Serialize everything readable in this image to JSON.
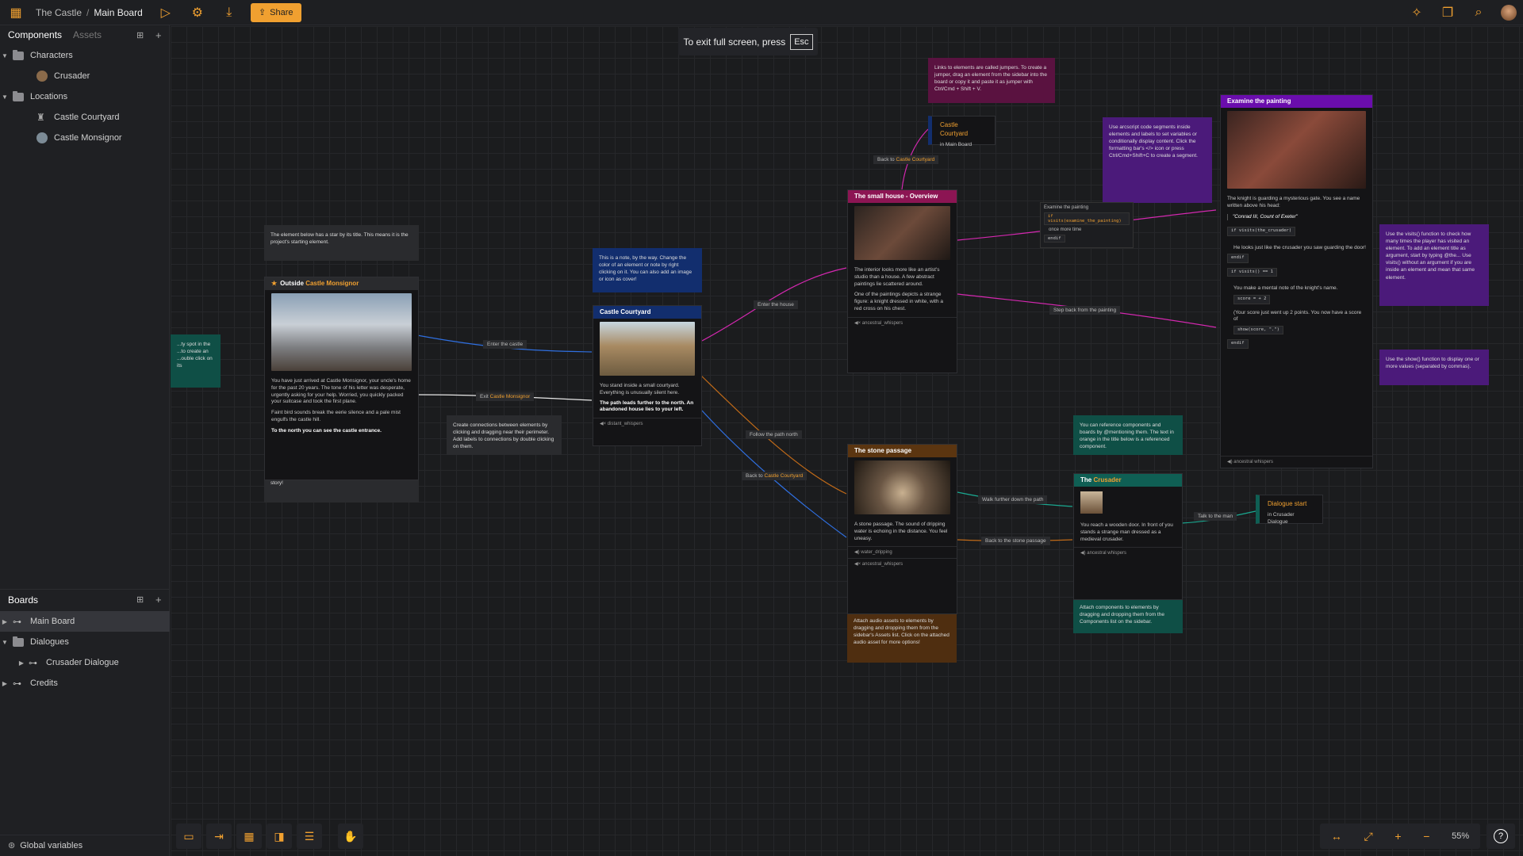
{
  "header": {
    "project": "The Castle",
    "separator": "/",
    "board": "Main Board",
    "share": "Share"
  },
  "sidebar": {
    "tab_components": "Components",
    "tab_assets": "Assets",
    "characters": "Characters",
    "crusader": "Crusader",
    "locations": "Locations",
    "courtyard": "Castle Courtyard",
    "monsignor": "Castle Monsignor",
    "boards_title": "Boards",
    "main_board": "Main Board",
    "dialogues": "Dialogues",
    "crusader_dialogue": "Crusader Dialogue",
    "credits": "Credits",
    "global_vars": "Global variables"
  },
  "fullscreen": {
    "text": "To exit full screen, press",
    "key": "Esc"
  },
  "nodes": {
    "outside": {
      "title_a": "Outside",
      "title_b": "Castle Monsignor",
      "body1": "You have just arrived at Castle Monsignor, your uncle's home for the past 20 years. The tone of his letter was desperate, urgently asking for your help. Worried, you quickly packed your suitcase and took the first plane.",
      "body2": "Faint bird sounds break the eerie silence and a pale mist engulfs the castle hill.",
      "body3": "To the north you can see the castle entrance."
    },
    "courtyard": {
      "title": "Castle Courtyard",
      "body1": "You stand inside a small courtyard. Everything is unusually silent here.",
      "body2": "The path leads further to the north. An abandoned house lies to your left.",
      "audio": "distant_whispers"
    },
    "house": {
      "title": "The small house - Overview",
      "body1": "The interior looks more like an artist's studio than a house. A few abstract paintings lie scattered around.",
      "body2": "One of the paintings depicts a strange figure: a knight dressed in white, with a red cross on his chest.",
      "audio": "ancestral_whispers"
    },
    "passage": {
      "title": "The stone passage",
      "body": "A stone passage. The sound of dripping water is echoing in the distance. You feel uneasy.",
      "audio1": "water_dripping",
      "audio2": "ancestral_whispers"
    },
    "crusader": {
      "title_a": "The",
      "title_b": "Crusader",
      "body": "You reach a wooden door. In front of you stands a strange man dressed as a medieval crusader.",
      "audio": "ancestral whispers"
    },
    "painting": {
      "title": "Examine the painting",
      "body1": "The knight is guarding a mysterious gate. You see a name written above his head:",
      "quote": "\"Conrad III, Count of Exeter\"",
      "code1": "if visits(the_crusader)",
      "body2": "He looks just like the crusader you saw guarding the door!",
      "code2": "endif",
      "code3": "if visits() == 1",
      "body3": "You make a mental note of the knight's name.",
      "code4": "score = + 2",
      "body4": "(Your score just went up 2 points. You now have a score of",
      "code5": "show(score, \".\")",
      "code6": "endif",
      "audio": "ancestral whispers"
    },
    "jumper": {
      "title": "Castle Courtyard",
      "sub": "in Main Board"
    },
    "dialogue": {
      "title": "Dialogue start",
      "sub": "in Crusader Dialogue"
    }
  },
  "notes": {
    "start": "The element below has a star by its title. This means it is the project's starting element.",
    "play": "Click on the Play Mode button on the top menu to run the story!",
    "note_blue": "This is a note, by the way. Change the color of an element or note by right clicking on it. You can also add an image or icon as cover!",
    "connections": "Create connections between elements by clicking and dragging near their perimeter. Add labels to connections by double clicking on them.",
    "jumpers": "Links to elements are called jumpers. To create a jumper, drag an element from the sidebar into the board or copy it and paste it as jumper with Ctrl/Cmd + Shift + V.",
    "arcscript": "Use arcscript code segments inside elements and labels to set variables or conditionally display content. Click the formatting bar's </> icon or press Ctrl/Cmd+Shift+C to create a segment.",
    "visits": "Use the visits() function to check how many times the player has visited an element. To add an element title as argument, start by typing @the... Use visits() without an argument if you are inside an element and mean that same element.",
    "show": "Use the show() function to display one or more values (separated by commas).",
    "reference": "You can reference components and boards by @mentioning them. The text in orange in the title below is a referenced component.",
    "components": "Attach components to elements by dragging and dropping them from the Components list on the sidebar.",
    "audio": "Attach audio assets to elements by dragging and dropping them from the sidebar's Assets list. Click on the attached audio asset for more options!",
    "left_partial": "...ty spot in the ...to create an ...ouble click on its"
  },
  "labels": {
    "enter_castle": "Enter the castle",
    "exit": "Exit",
    "exit_target": "Castle Monsignor",
    "enter_house": "Enter the house",
    "follow_path": "Follow the path north",
    "back_courtyard": "Back to",
    "back_courtyard_target": "Castle Courtyard",
    "back_jump": "Back to",
    "back_jump_target": "Castle Courtyard",
    "walk_further": "Walk further down the path",
    "back_passage": "Back to the stone passage",
    "talk_man": "Talk to the man",
    "step_back": "Step back from the painting",
    "examine": "Examine the painting",
    "examine_code": "if visits(examine_the_painting)",
    "once_more": "once more time",
    "endif": "endif"
  },
  "zoom": "55%",
  "colors": {
    "accent": "#f0a030",
    "crimson": "#8c1553",
    "purple": "#6a0dad",
    "teal": "#0f5f54",
    "navy": "#122e6e",
    "brown": "#5b3510"
  }
}
